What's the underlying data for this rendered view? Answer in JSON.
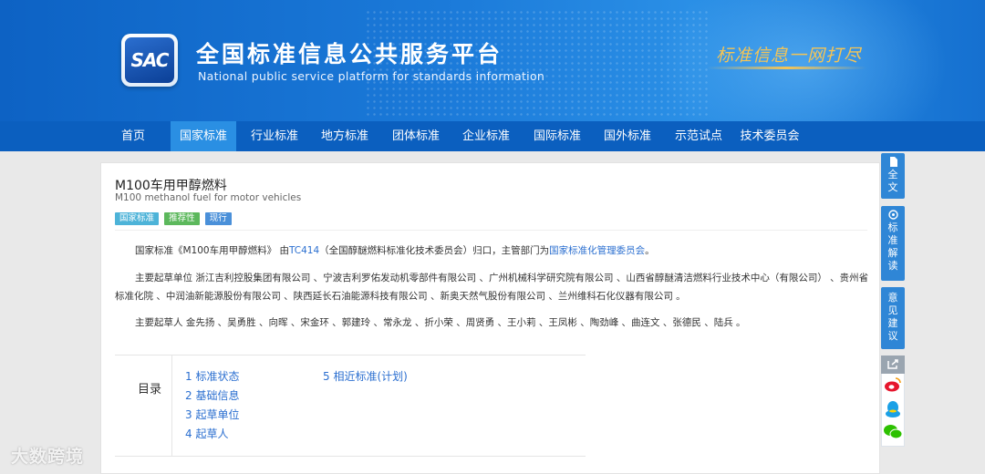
{
  "header": {
    "logo_text": "SAC",
    "title": "全国标准信息公共服务平台",
    "subtitle": "National public service platform  for standards information",
    "slogan": "标准信息一网打尽"
  },
  "nav": {
    "items": [
      {
        "label": "首页"
      },
      {
        "label": "国家标准"
      },
      {
        "label": "行业标准"
      },
      {
        "label": "地方标准"
      },
      {
        "label": "团体标准"
      },
      {
        "label": "企业标准"
      },
      {
        "label": "国际标准"
      },
      {
        "label": "国外标准"
      },
      {
        "label": "示范试点"
      },
      {
        "label": "技术委员会"
      }
    ],
    "active_index": 1
  },
  "standard": {
    "title": "M100车用甲醇燃料",
    "title_en": "M100 methanol fuel for motor vehicles",
    "tags": [
      {
        "label": "国家标准",
        "color": "#4db3d8"
      },
      {
        "label": "推荐性",
        "color": "#5cb85c"
      },
      {
        "label": "现行",
        "color": "#4a90d9"
      }
    ],
    "summary": {
      "prefix": "国家标准《M100车用甲醇燃料》 由",
      "tc_link": "TC414",
      "middle": "（全国醇醚燃料标准化技术委员会）归口，主管部门为",
      "dept_link": "国家标准化管理委员会",
      "suffix": "。"
    },
    "drafting_units": "主要起草单位 浙江吉利控股集团有限公司 、宁波吉利罗佑发动机零部件有限公司 、广州机械科学研究院有限公司 、山西省醇醚清洁燃料行业技术中心（有限公司） 、贵州省标准化院 、中润油新能源股份有限公司 、陕西延长石油能源科技有限公司 、新奥天然气股份有限公司 、兰州维科石化仪器有限公司 。",
    "drafters": "主要起草人 金先扬 、吴勇胜 、向晖 、宋金环 、郭建玲 、常永龙 、折小荣 、周贤勇 、王小莉 、王凤彬 、陶劲峰 、曲连文 、张德民 、陆兵 。"
  },
  "toc": {
    "label": "目录",
    "items": [
      {
        "label": "1  标准状态"
      },
      {
        "label": "2  基础信息"
      },
      {
        "label": "3  起草单位"
      },
      {
        "label": "4  起草人"
      },
      {
        "label": "5  相近标准(计划)"
      }
    ]
  },
  "sidebar": {
    "fulltext": "全文",
    "interpret": "标准解读",
    "feedback": "意见建议"
  },
  "watermark": "大数跨境"
}
